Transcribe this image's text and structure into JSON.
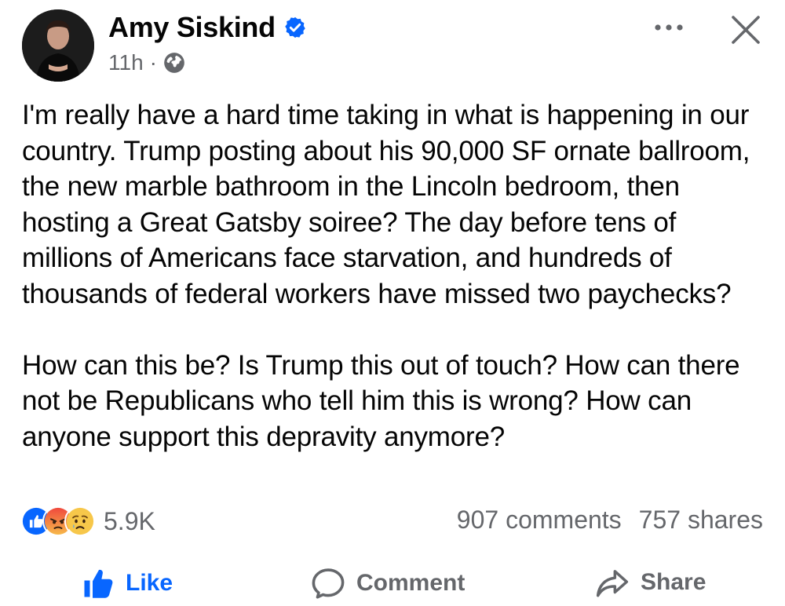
{
  "post": {
    "author": "Amy Siskind",
    "time": "11h",
    "separator": "·",
    "audience_icon": "globe-icon",
    "verified_icon": "verified-badge-icon",
    "body": [
      "I'm really have a hard time taking in what is happening in our country. Trump posting about his 90,000 SF ornate ballroom, the new marble bathroom in the Lincoln bedroom, then hosting a Great Gatsby soiree? The day before tens of millions of Americans face starvation, and hundreds of thousands of federal workers have missed two paychecks?",
      "How can this be? Is Trump this out of touch? How can there not be Republicans who tell him this is wrong? How can anyone support this depravity anymore?"
    ]
  },
  "reactions": {
    "icons": [
      "like-reaction-icon",
      "angry-reaction-icon",
      "sad-reaction-icon"
    ],
    "count": "5.9K"
  },
  "stats": {
    "comments": "907 comments",
    "shares": "757 shares"
  },
  "actions": {
    "like": "Like",
    "comment": "Comment",
    "share": "Share"
  },
  "colors": {
    "text": "#050505",
    "secondary": "#65676b",
    "accent": "#0866ff",
    "verified": "#0866ff",
    "angry": "#f0493d",
    "sad": "#f7c74a"
  }
}
